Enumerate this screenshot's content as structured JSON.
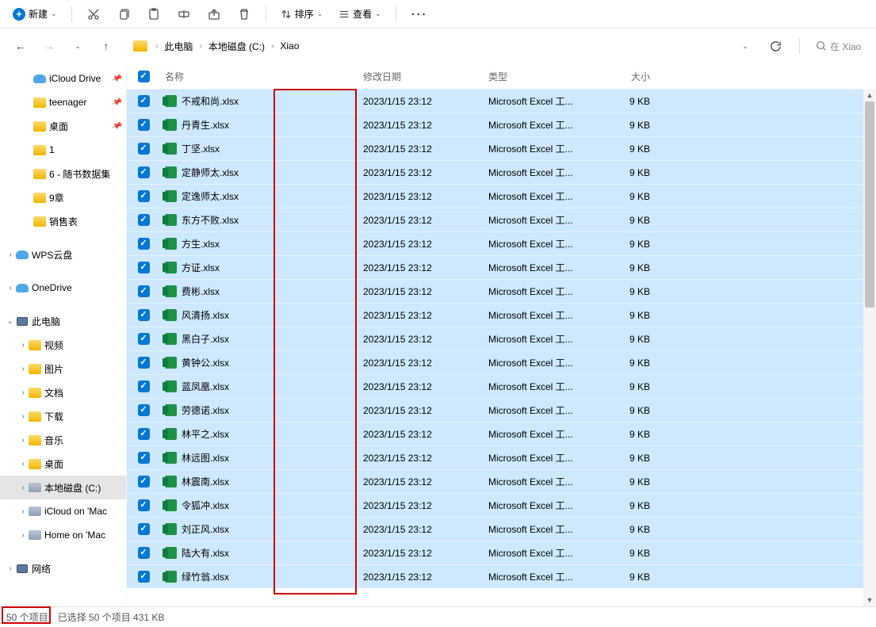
{
  "toolbar": {
    "new_label": "新建",
    "sort_label": "排序",
    "view_label": "查看"
  },
  "breadcrumb": [
    "此电脑",
    "本地磁盘 (C:)",
    "Xiao"
  ],
  "search": {
    "placeholder": "在 Xiao"
  },
  "sidebar": [
    {
      "label": "iCloud Drive",
      "type": "cloud",
      "chevron": "",
      "indent": 28,
      "pin": true
    },
    {
      "label": "teenager",
      "type": "folder",
      "chevron": "",
      "indent": 28,
      "pin": true
    },
    {
      "label": "桌面",
      "type": "folder",
      "chevron": "",
      "indent": 28,
      "pin": true
    },
    {
      "label": "1",
      "type": "folder",
      "chevron": "",
      "indent": 28
    },
    {
      "label": "6 - 随书数据集",
      "type": "folder",
      "chevron": "",
      "indent": 28
    },
    {
      "label": "9章",
      "type": "folder",
      "chevron": "",
      "indent": 28
    },
    {
      "label": "销售表",
      "type": "folder",
      "chevron": "",
      "indent": 28
    },
    {
      "spacer": true
    },
    {
      "label": "WPS云盘",
      "type": "cloud",
      "chevron": "›",
      "indent": 6
    },
    {
      "spacer": true
    },
    {
      "label": "OneDrive",
      "type": "cloud",
      "chevron": "›",
      "indent": 6
    },
    {
      "spacer": true
    },
    {
      "label": "此电脑",
      "type": "monitor",
      "chevron": "⌄",
      "indent": 6
    },
    {
      "label": "视频",
      "type": "folder",
      "chevron": "›",
      "indent": 22
    },
    {
      "label": "图片",
      "type": "folder",
      "chevron": "›",
      "indent": 22
    },
    {
      "label": "文档",
      "type": "folder",
      "chevron": "›",
      "indent": 22
    },
    {
      "label": "下载",
      "type": "folder",
      "chevron": "›",
      "indent": 22
    },
    {
      "label": "音乐",
      "type": "folder",
      "chevron": "›",
      "indent": 22
    },
    {
      "label": "桌面",
      "type": "folder",
      "chevron": "›",
      "indent": 22
    },
    {
      "label": "本地磁盘 (C:)",
      "type": "disk",
      "chevron": "›",
      "indent": 22,
      "selected": true
    },
    {
      "label": "iCloud on 'Mac",
      "type": "disk",
      "chevron": "›",
      "indent": 22
    },
    {
      "label": "Home on 'Mac",
      "type": "disk",
      "chevron": "›",
      "indent": 22
    },
    {
      "spacer": true
    },
    {
      "label": "网络",
      "type": "monitor",
      "chevron": "›",
      "indent": 6
    }
  ],
  "columns": {
    "name": "名称",
    "date": "修改日期",
    "type": "类型",
    "size": "大小"
  },
  "file_defaults": {
    "date": "2023/1/15 23:12",
    "type": "Microsoft Excel 工...",
    "size": "9 KB"
  },
  "files": [
    {
      "name": "不戒和尚.xlsx"
    },
    {
      "name": "丹青生.xlsx"
    },
    {
      "name": "丁坚.xlsx"
    },
    {
      "name": "定静师太.xlsx"
    },
    {
      "name": "定逸师太.xlsx"
    },
    {
      "name": "东方不败.xlsx"
    },
    {
      "name": "方生.xlsx"
    },
    {
      "name": "方证.xlsx"
    },
    {
      "name": "费彬.xlsx"
    },
    {
      "name": "风清扬.xlsx"
    },
    {
      "name": "黑白子.xlsx"
    },
    {
      "name": "黄钟公.xlsx"
    },
    {
      "name": "蓝凤凰.xlsx"
    },
    {
      "name": "劳德诺.xlsx"
    },
    {
      "name": "林平之.xlsx"
    },
    {
      "name": "林远图.xlsx"
    },
    {
      "name": "林震南.xlsx"
    },
    {
      "name": "令狐冲.xlsx"
    },
    {
      "name": "刘正风.xlsx"
    },
    {
      "name": "陆大有.xlsx"
    },
    {
      "name": "绿竹翁.xlsx"
    }
  ],
  "statusbar": {
    "items": "50 个项目",
    "selected": "已选择 50 个项目  431 KB"
  }
}
